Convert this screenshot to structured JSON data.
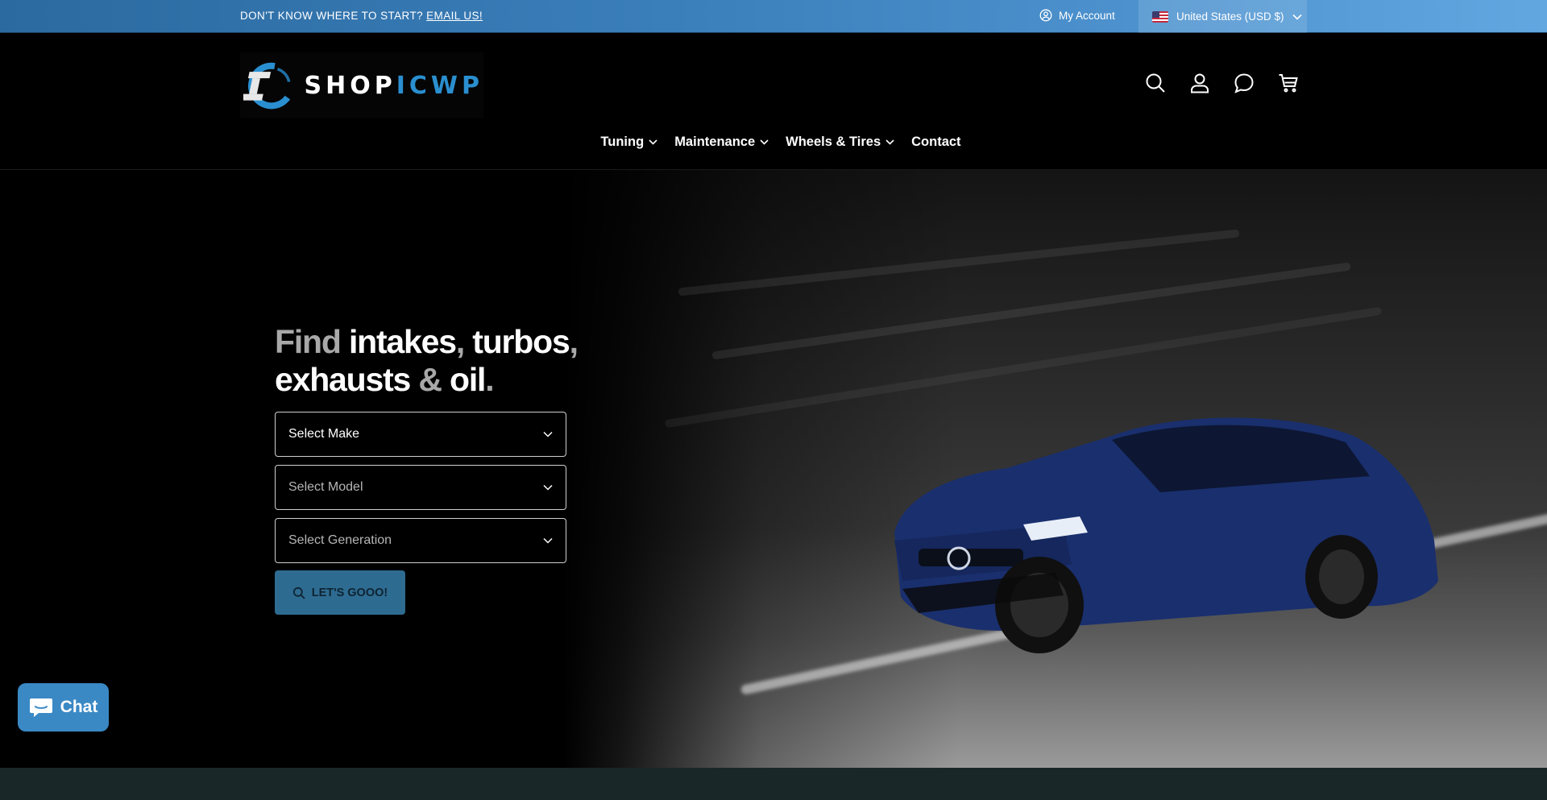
{
  "announcement": {
    "text": "DON'T KNOW WHERE TO START?",
    "link": "EMAIL US!",
    "account": "My Account",
    "currency": "United States (USD $)"
  },
  "logo": {
    "part1": "SHOP",
    "part2": "ICWP"
  },
  "nav": {
    "items": [
      {
        "label": "Tuning",
        "has_dropdown": true
      },
      {
        "label": "Maintenance",
        "has_dropdown": true
      },
      {
        "label": "Wheels & Tires",
        "has_dropdown": true
      },
      {
        "label": "Contact",
        "has_dropdown": false
      }
    ]
  },
  "header_icons": [
    "search-icon",
    "account-icon",
    "chat-bubble-icon",
    "cart-icon"
  ],
  "hero": {
    "title": {
      "find": "Find",
      "intakes": "intakes",
      "c1": ",",
      "turbos": "turbos",
      "c2": ",",
      "exhausts": "exhausts",
      "amp": "&",
      "oil": "oil",
      "dot": "."
    },
    "selects": {
      "make": "Select Make",
      "model": "Select Model",
      "generation": "Select Generation"
    },
    "button": "LET'S GOOO!"
  },
  "chat": {
    "label": "Chat"
  },
  "colors": {
    "accent": "#2a8fd0",
    "button": "#2e6b90",
    "chat": "#3a89c5",
    "announce_start": "#2b6aa0",
    "announce_end": "#62a7e0"
  }
}
